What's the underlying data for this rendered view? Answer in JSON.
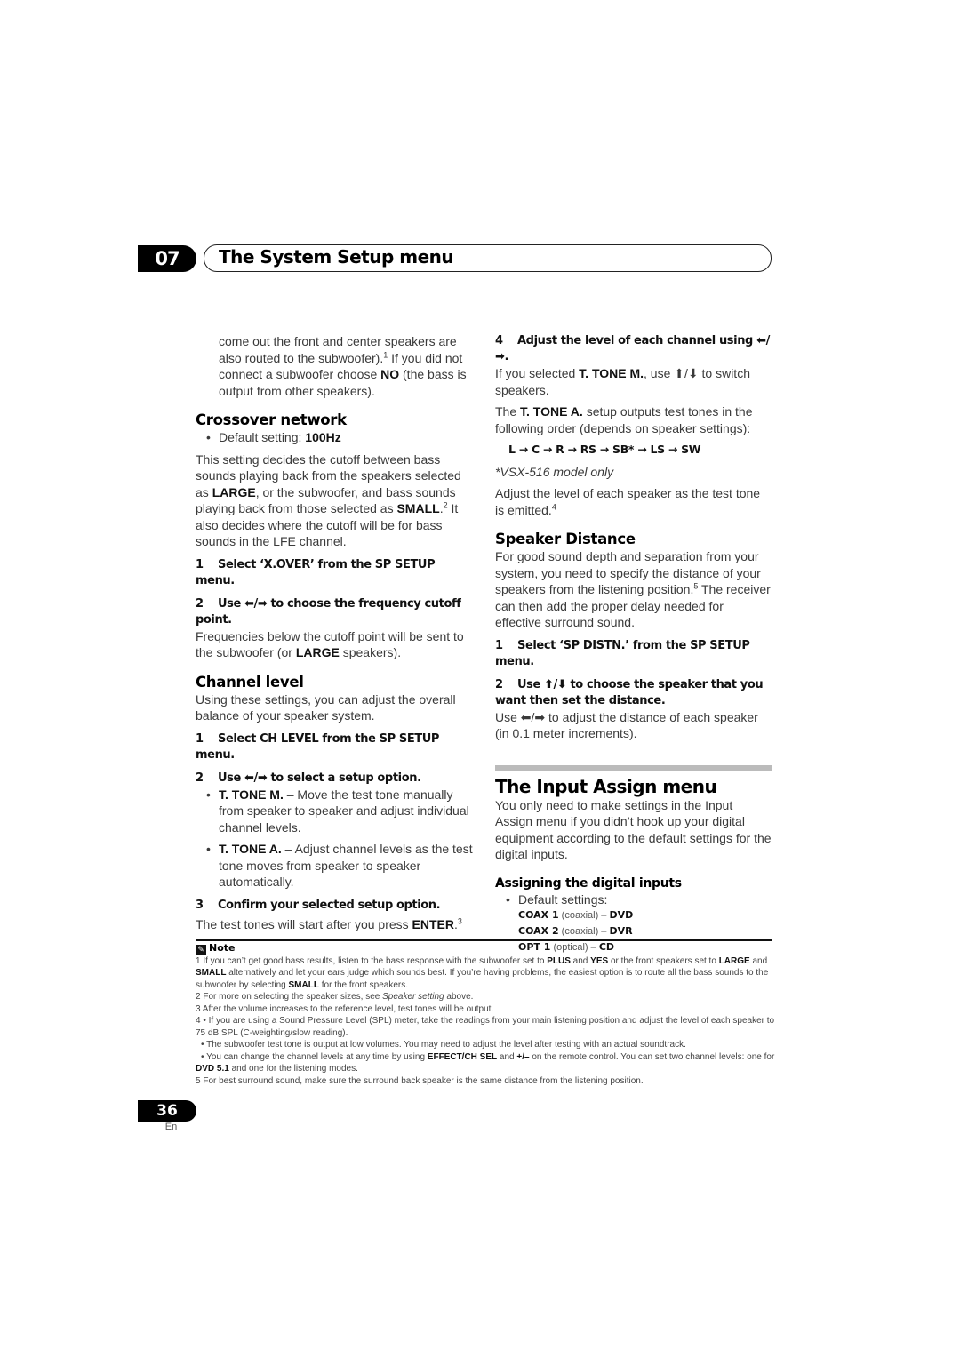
{
  "header": {
    "chapter_number": "07",
    "chapter_title": "The System Setup menu"
  },
  "left": {
    "intro": {
      "t1": "come out the front and center speakers are also routed to the subwoofer).",
      "sup1": "1",
      "t2": " If you did not connect a subwoofer choose ",
      "b1": "NO",
      "t3": " (the bass is output from other speakers)."
    },
    "crossover": {
      "heading": "Crossover network",
      "default_label": "Default setting: ",
      "default_value": "100Hz",
      "desc": {
        "t1": "This setting decides the cutoff between bass sounds playing back from the speakers selected as ",
        "b1": "LARGE",
        "t2": ", or the subwoofer, and bass sounds playing back from those selected as ",
        "b2": "SMALL",
        "t3": ".",
        "sup": "2",
        "t4": " It also decides where the cutoff will be for bass sounds in the LFE channel."
      },
      "step1": {
        "n": "1",
        "text": "Select ‘X.OVER’ from the SP SETUP menu."
      },
      "step2": {
        "n": "2",
        "text": "Use ⬅/➡ to choose the frequency cutoff point."
      },
      "step2_desc": {
        "t1": "Frequencies below the cutoff point will be sent to the subwoofer (or ",
        "b1": "LARGE",
        "t2": " speakers)."
      }
    },
    "channel_level": {
      "heading": "Channel level",
      "desc": "Using these settings, you can adjust the overall balance of your speaker system.",
      "step1": {
        "n": "1",
        "text": "Select CH LEVEL from the SP SETUP menu."
      },
      "step2": {
        "n": "2",
        "text": "Use ⬅/➡ to select a setup option."
      },
      "bullets": [
        {
          "b": "T. TONE M.",
          "t": " – Move the test tone manually from speaker to speaker and adjust individual channel levels."
        },
        {
          "b": "T. TONE A.",
          "t": " – Adjust channel levels as the test tone moves from speaker to speaker automatically."
        }
      ],
      "step3": {
        "n": "3",
        "text": "Confirm your selected setup option."
      },
      "step3_desc": {
        "t1": "The test tones will start after you press ",
        "b1": "ENTER",
        "t2": ".",
        "sup": "3"
      }
    }
  },
  "right": {
    "step4": {
      "n": "4",
      "text": "Adjust the level of each channel using ⬅/➡."
    },
    "step4_desc": {
      "t1": "If you selected ",
      "b1": "T. TONE M.",
      "t2": ", use ⬆/⬇ to switch speakers."
    },
    "tone_a_desc": {
      "t1": "The ",
      "b1": "T. TONE A.",
      "t2": " setup outputs test tones in the following order (depends on speaker settings):"
    },
    "order": "L → C → R → RS → SB* → LS → SW",
    "order_note": "*VSX-516 model only",
    "adjust_desc": {
      "t1": "Adjust the level of each speaker as the test tone is emitted.",
      "sup": "4"
    },
    "speaker_distance": {
      "heading": "Speaker Distance",
      "desc": {
        "t1": "For good sound depth and separation from your system, you need to specify the distance of your speakers from the listening position.",
        "sup": "5",
        "t2": " The receiver can then add the proper delay needed for effective surround sound."
      },
      "step1": {
        "n": "1",
        "text": "Select ‘SP DISTN.’ from the SP SETUP menu."
      },
      "step2": {
        "n": "2",
        "text": "Use ⬆/⬇ to choose the speaker that you want then set the distance."
      },
      "step2_desc": "Use ⬅/➡ to adjust the distance of each speaker (in 0.1 meter increments)."
    },
    "input_assign": {
      "heading": "The Input Assign menu",
      "desc": "You only need to make settings in the Input Assign menu if you didn’t hook up your digital equipment according to the default settings for the digital inputs.",
      "subheading": "Assigning the digital inputs",
      "default_label": "Default settings:",
      "defaults": [
        {
          "input": "COAX 1",
          "type": " (coaxial) – ",
          "device": "DVD"
        },
        {
          "input": "COAX 2",
          "type": " (coaxial) – ",
          "device": "DVR"
        },
        {
          "input": "OPT 1",
          "type": " (optical) – ",
          "device": "CD"
        }
      ]
    }
  },
  "notes": {
    "heading": "Note",
    "n1": {
      "t1": "1 If you can’t get good bass results, listen to the bass response with the subwoofer set to ",
      "b1": "PLUS",
      "t2": " and ",
      "b2": "YES",
      "t3": " or the front speakers set to ",
      "b3": "LARGE",
      "t4": " and ",
      "b4": "SMALL",
      "t5": " alternatively and let your ears judge which sounds best. If you’re having problems, the easiest option is to route all the bass sounds to the subwoofer by selecting ",
      "b5": "SMALL",
      "t6": " for the front speakers."
    },
    "n2": {
      "t1": "2 For more on selecting the speaker sizes, see ",
      "i1": "Speaker setting",
      "t2": " above."
    },
    "n3": "3 After the volume increases to the reference level, test tones will be output.",
    "n4a": "4 • If you are using a Sound Pressure Level (SPL) meter, take the readings from your main listening position and adjust the level of each speaker to 75 dB SPL (C-weighting/slow reading).",
    "n4b": "• The subwoofer test tone is output at low volumes. You may need to adjust the level after testing with an actual soundtrack.",
    "n4c": {
      "t1": "• You can change the channel levels at any time by using ",
      "b1": "EFFECT/CH SEL",
      "t2": " and ",
      "b2": "+/–",
      "t3": " on the remote control. You can set two channel levels: one for ",
      "b3": "DVD 5.1",
      "t4": " and one for the listening modes."
    },
    "n5": "5 For best surround sound, make sure the surround back speaker is the same distance from the listening position."
  },
  "footer": {
    "page_number": "36",
    "language": "En"
  }
}
